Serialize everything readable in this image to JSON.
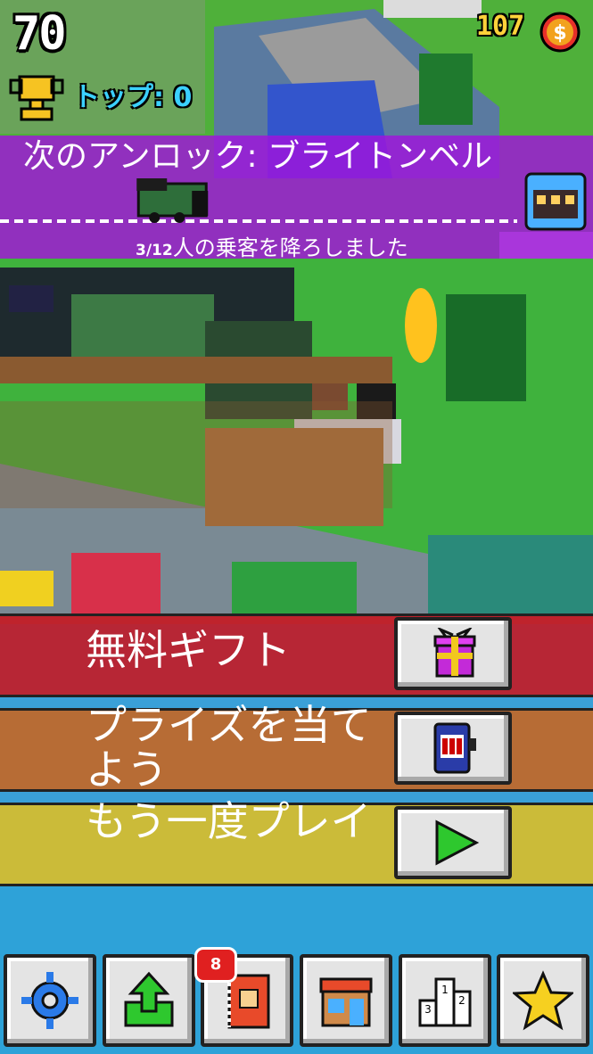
{
  "hud": {
    "score": "70",
    "best_label": "トップ: 0",
    "coins": "107"
  },
  "unlock": {
    "title": "次のアンロック: ブライトンベル",
    "progress_count": "3/12",
    "progress_text": "人の乗客を降ろしました",
    "progress_fraction": 0.25
  },
  "menu": {
    "free_gift": "無料ギフト",
    "win_prize": "プライズを当てよう",
    "play_again": "もう一度プレイ"
  },
  "toolbar": {
    "notification_count": "8"
  },
  "colors": {
    "unlock_band": "#a014dc",
    "free_gift_row": "#c8141e",
    "win_prize_row": "#c8641e",
    "play_again_row": "#dcbe28",
    "best_text": "#3bd0ff",
    "coin_text": "#ffd23a"
  },
  "icons": [
    "trophy-icon",
    "coin-icon",
    "train-icon",
    "carriage-icon",
    "gift-icon",
    "slot-machine-icon",
    "play-icon",
    "gear-icon",
    "share-icon",
    "character-book-icon",
    "shop-icon",
    "leaderboard-icon",
    "star-icon"
  ]
}
